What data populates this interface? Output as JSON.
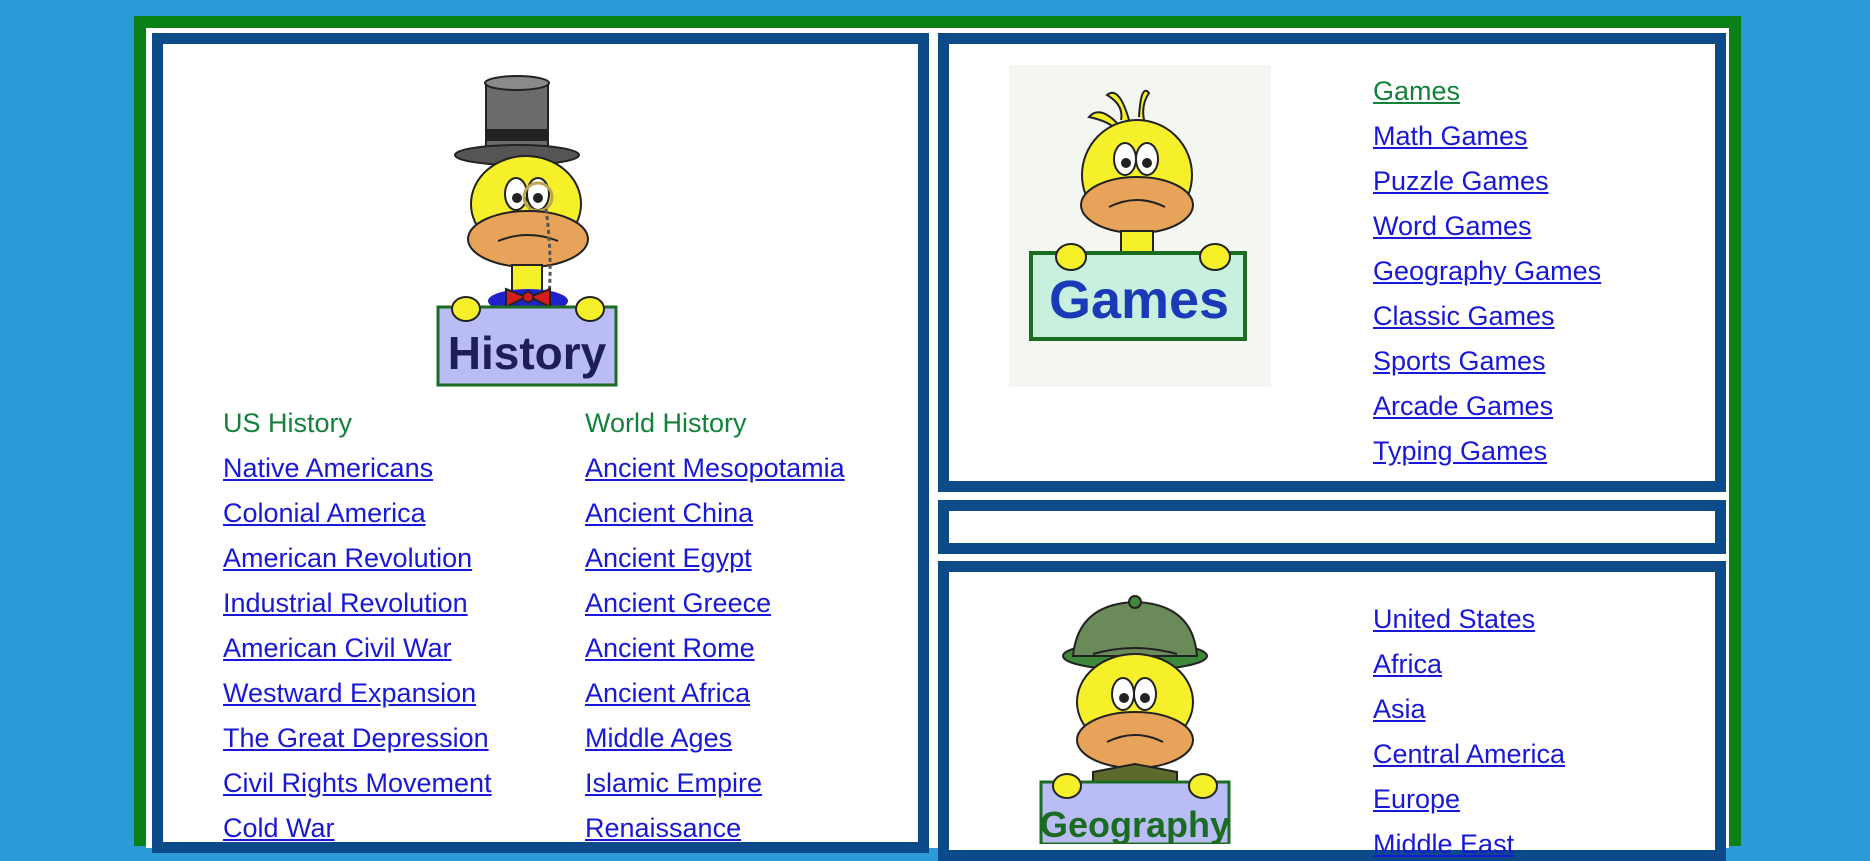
{
  "history": {
    "sign_label": "History",
    "us_header": "US History",
    "world_header": "World History",
    "us_links": [
      "Native Americans",
      "Colonial America",
      "American Revolution",
      "Industrial Revolution",
      "American Civil War",
      "Westward Expansion",
      "The Great Depression",
      "Civil Rights Movement",
      "Cold War"
    ],
    "world_links": [
      "Ancient Mesopotamia",
      "Ancient China",
      "Ancient Egypt",
      "Ancient Greece",
      "Ancient Rome",
      "Ancient Africa",
      "Middle Ages",
      "Islamic Empire",
      "Renaissance"
    ]
  },
  "games": {
    "sign_label": "Games",
    "links": [
      "Games",
      "Math Games",
      "Puzzle Games",
      "Word Games",
      "Geography Games",
      "Classic Games",
      "Sports Games",
      "Arcade Games",
      "Typing Games"
    ]
  },
  "geography": {
    "sign_label": "Geography",
    "links": [
      "United States",
      "Africa",
      "Asia",
      "Central America",
      "Europe",
      "Middle East"
    ]
  },
  "colors": {
    "background": "#2b9bd8",
    "outer_frame": "#0a8117",
    "panel_border": "#0c4a89",
    "link": "#1818d6",
    "header_green": "#13813a"
  }
}
